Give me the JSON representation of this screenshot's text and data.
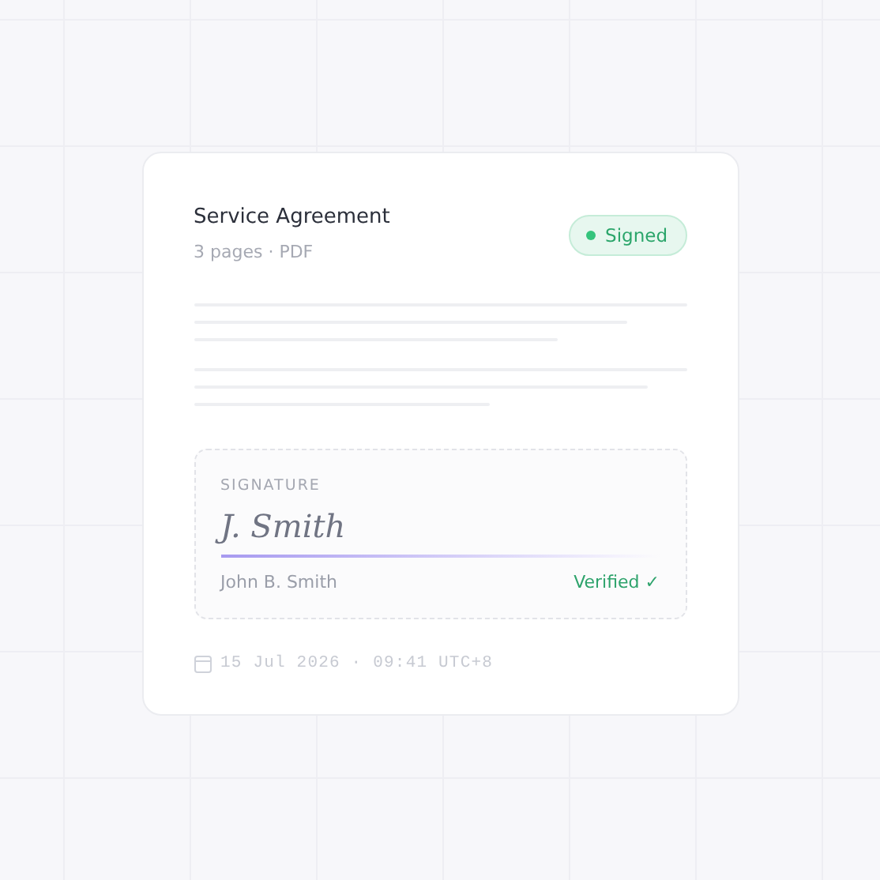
{
  "document": {
    "title": "Service Agreement",
    "meta": "3 pages · PDF"
  },
  "status": {
    "label": "Signed",
    "kind": "signed"
  },
  "signature": {
    "heading": "SIGNATURE",
    "signature_text": "J. Smith",
    "signer": "John B. Smith",
    "verification": "Verified ✓",
    "verified": true
  },
  "timestamp": "15 Jul 2026 · 09:41 UTC+8"
}
